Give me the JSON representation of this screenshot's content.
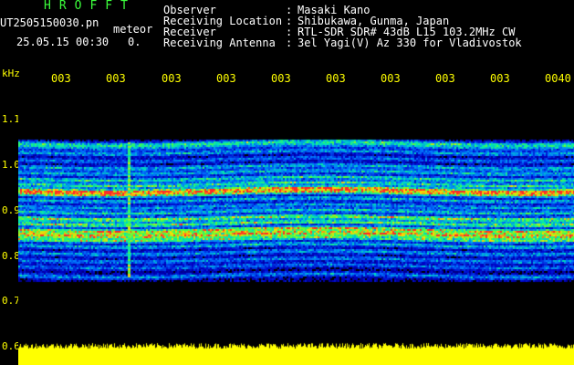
{
  "header": {
    "app_title": "HROFFT",
    "file_name": "UT2505150030.pn",
    "meteor_label": "meteor",
    "date_time": "25.05.15 00:30",
    "count": "0.",
    "info": [
      {
        "label": "Observer",
        "value": "Masaki Kano"
      },
      {
        "label": "Receiving Location",
        "value": "Shibukawa, Gunma, Japan"
      },
      {
        "label": "Receiver",
        "value": "RTL-SDR SDR# 43dB L15 103.2MHz CW"
      },
      {
        "label": "Receiving Antenna",
        "value": "3el Yagi(V) Az 330 for Vladivostok"
      }
    ]
  },
  "axes": {
    "unit": "kHz",
    "time_labels": [
      "003",
      "003",
      "003",
      "003",
      "003",
      "003",
      "003",
      "003",
      "003",
      "0040"
    ],
    "freq_labels": [
      "1.1",
      "1.0",
      "0.9",
      "0.8",
      "0.7",
      "0.6"
    ]
  },
  "colors": {
    "title": "#3cff3c",
    "labels": "#ffff00",
    "text": "#ffffff",
    "background": "#000000",
    "audio_level": "#ffff00"
  }
}
